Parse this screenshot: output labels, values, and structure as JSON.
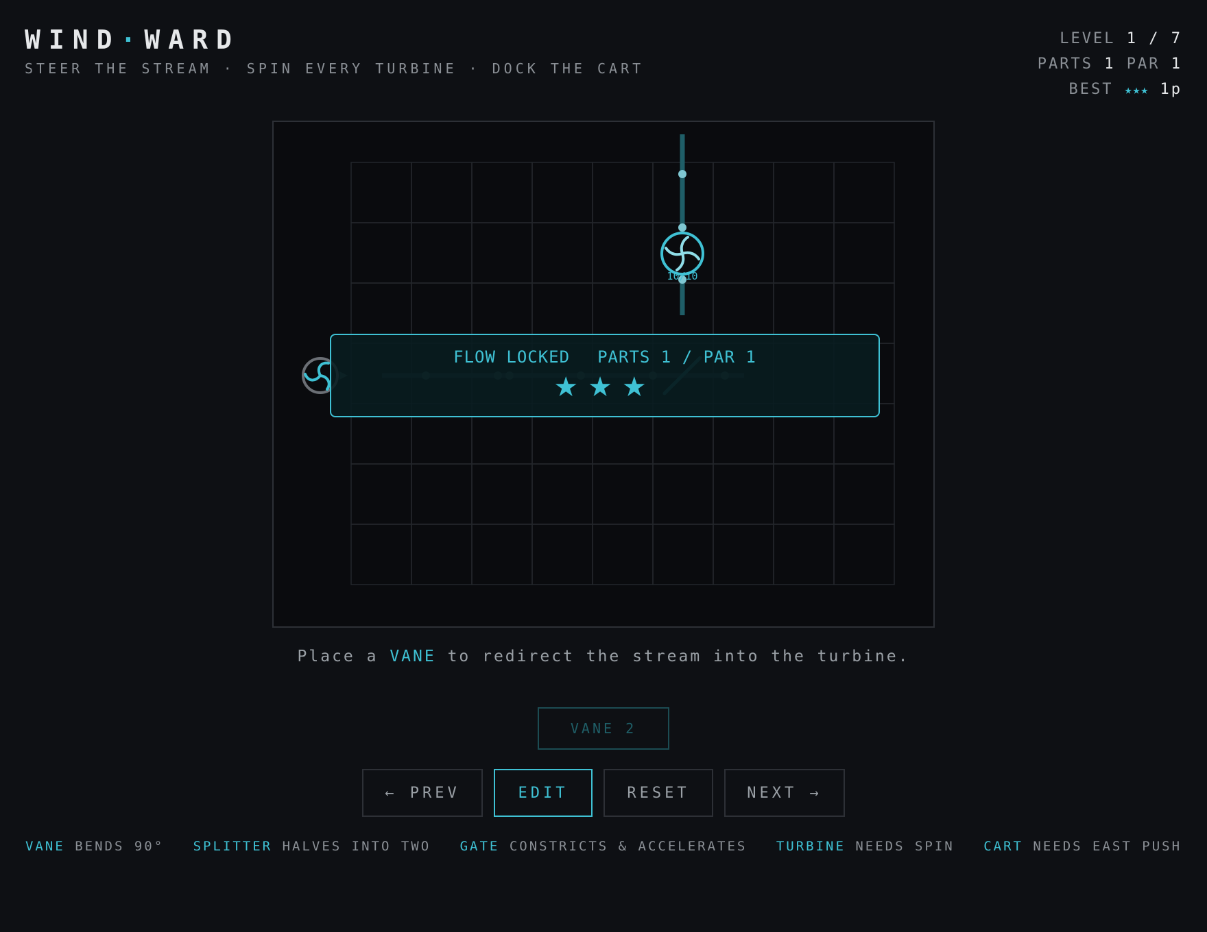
{
  "app": {
    "title_left": "WIND",
    "title_sep": "·",
    "title_right": "WARD",
    "subtitle": "STEER THE STREAM · SPIN EVERY TURBINE · DOCK THE CART"
  },
  "hud": {
    "level_label": "LEVEL",
    "level_value": "1 / 7",
    "parts_label": "PARTS",
    "parts_value": "1",
    "par_label": "PAR",
    "par_value": "1",
    "best_label": "BEST",
    "best_stars": "★★★",
    "best_value": "1p"
  },
  "board": {
    "grid_cols": 9,
    "grid_rows": 7,
    "turbine_label": "10/10",
    "pieces": [
      "turbine",
      "fan-source",
      "vane"
    ]
  },
  "banner": {
    "status": "FLOW LOCKED",
    "parts": "PARTS 1 / PAR 1",
    "stars": "★★★",
    "star_count": 3,
    "star_max": 3
  },
  "hint": {
    "before": "Place a ",
    "keyword": "VANE",
    "after": " to redirect the stream into the turbine."
  },
  "part_button": {
    "label": "VANE 2"
  },
  "controls": {
    "prev": "← PREV",
    "edit": "EDIT",
    "reset": "RESET",
    "next": "NEXT →"
  },
  "legend": [
    {
      "key": "VANE",
      "desc": "BENDS 90°"
    },
    {
      "key": "SPLITTER",
      "desc": "HALVES INTO TWO"
    },
    {
      "key": "GATE",
      "desc": "CONSTRICTS & ACCELERATES"
    },
    {
      "key": "TURBINE",
      "desc": "NEEDS SPIN"
    },
    {
      "key": "CART",
      "desc": "NEEDS EAST PUSH"
    }
  ],
  "colors": {
    "background": "#0e1014",
    "accent": "#3fc1d4",
    "text": "#9aa0a6",
    "bright": "#e6e8ea"
  }
}
